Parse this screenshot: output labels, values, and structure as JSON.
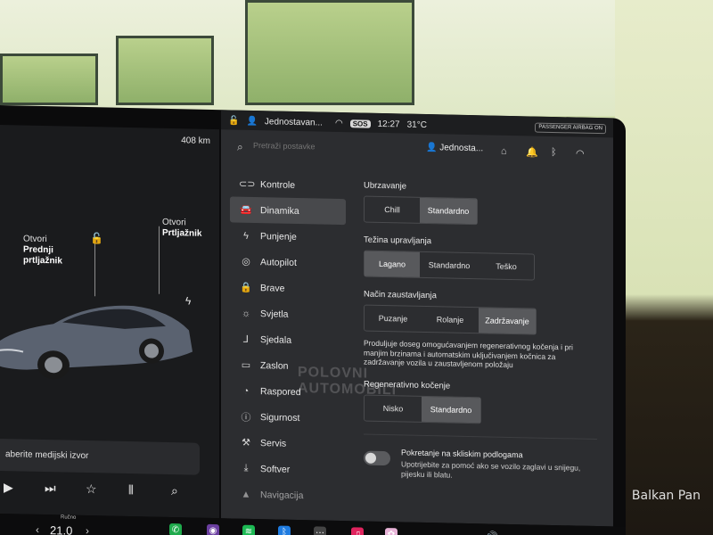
{
  "status_bar": {
    "user": "Jednostavan...",
    "sos": "SOS",
    "time": "12:27",
    "temperature": "31°C",
    "airbag": "PASSENGER AIRBAG ON"
  },
  "left_panel": {
    "range": "408 km",
    "frunk_label_1": "Otvori",
    "frunk_label_2": "Prednji",
    "frunk_label_3": "prtljažnik",
    "trunk_label_1": "Otvori",
    "trunk_label_2": "Prtljažnik",
    "media_prompt": "aberite medijski izvor"
  },
  "header": {
    "search_placeholder": "Pretraži postavke",
    "user_name": "Jednosta..."
  },
  "sidebar": {
    "items": [
      {
        "label": "Kontrole",
        "icon": "toggle-icon"
      },
      {
        "label": "Dinamika",
        "icon": "car-icon"
      },
      {
        "label": "Punjenje",
        "icon": "bolt-icon"
      },
      {
        "label": "Autopilot",
        "icon": "steering-wheel-icon"
      },
      {
        "label": "Brave",
        "icon": "lock-icon"
      },
      {
        "label": "Svjetla",
        "icon": "sun-icon"
      },
      {
        "label": "Sjedala",
        "icon": "seat-icon"
      },
      {
        "label": "Zaslon",
        "icon": "display-icon"
      },
      {
        "label": "Raspored",
        "icon": "calendar-icon"
      },
      {
        "label": "Sigurnost",
        "icon": "info-icon"
      },
      {
        "label": "Servis",
        "icon": "wrench-icon"
      },
      {
        "label": "Softver",
        "icon": "download-icon"
      },
      {
        "label": "Navigacija",
        "icon": "navigation-icon"
      }
    ],
    "active": "Dinamika"
  },
  "settings": {
    "acceleration": {
      "title": "Ubrzavanje",
      "options": [
        "Chill",
        "Standardno"
      ],
      "selected": "Standardno"
    },
    "steering": {
      "title": "Težina upravljanja",
      "options": [
        "Lagano",
        "Standardno",
        "Teško"
      ],
      "selected": "Lagano"
    },
    "stopping": {
      "title": "Način zaustavljanja",
      "options": [
        "Puzanje",
        "Rolanje",
        "Zadržavanje"
      ],
      "selected": "Zadržavanje",
      "description": "Produljuje doseg omogućavanjem regenerativnog kočenja i pri manjim brzinama i automatskim uključivanjem kočnica za zadržavanje vozila u zaustavljenom položaju"
    },
    "regen": {
      "title": "Regenerativno kočenje",
      "options": [
        "Nisko",
        "Standardno"
      ],
      "selected": "Standardno"
    },
    "slip_start": {
      "title": "Pokretanje na skliskim podlogama",
      "subtitle": "Upotrijebite za pomoć ako se vozilo zaglavi u snijegu, pijesku ili blatu.",
      "enabled": false
    }
  },
  "dock": {
    "manual_label": "Ručno",
    "cabin_temp": "21.0"
  },
  "watermark": {
    "overlay": "POLOVNI AUTOMOBILI",
    "photo_credit": "Balkan Pan"
  }
}
